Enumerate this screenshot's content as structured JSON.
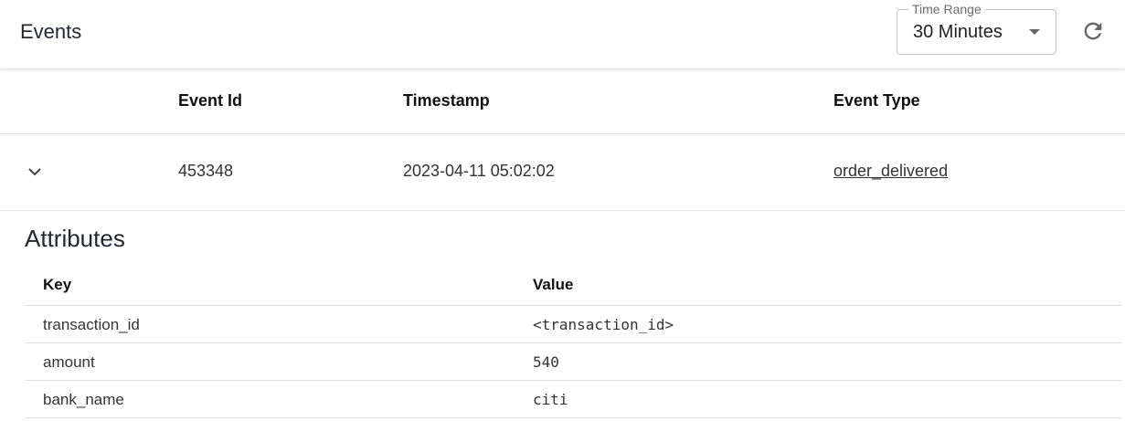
{
  "header": {
    "title": "Events",
    "time_range": {
      "label": "Time Range",
      "value": "30 Minutes"
    },
    "refresh_icon": "refresh-icon"
  },
  "events_table": {
    "columns": [
      "Event Id",
      "Timestamp",
      "Event Type"
    ],
    "rows": [
      {
        "event_id": "453348",
        "timestamp": "2023-04-11 05:02:02",
        "event_type": "order_delivered",
        "expanded": true
      }
    ]
  },
  "attributes": {
    "title": "Attributes",
    "columns": [
      "Key",
      "Value"
    ],
    "rows": [
      {
        "key": "transaction_id",
        "value": "<transaction_id>"
      },
      {
        "key": "amount",
        "value": "540"
      },
      {
        "key": "bank_name",
        "value": "citi"
      }
    ]
  },
  "colors": {
    "text": "#1f2733",
    "divider": "#e1e4e8",
    "border": "#c4c4c4"
  }
}
